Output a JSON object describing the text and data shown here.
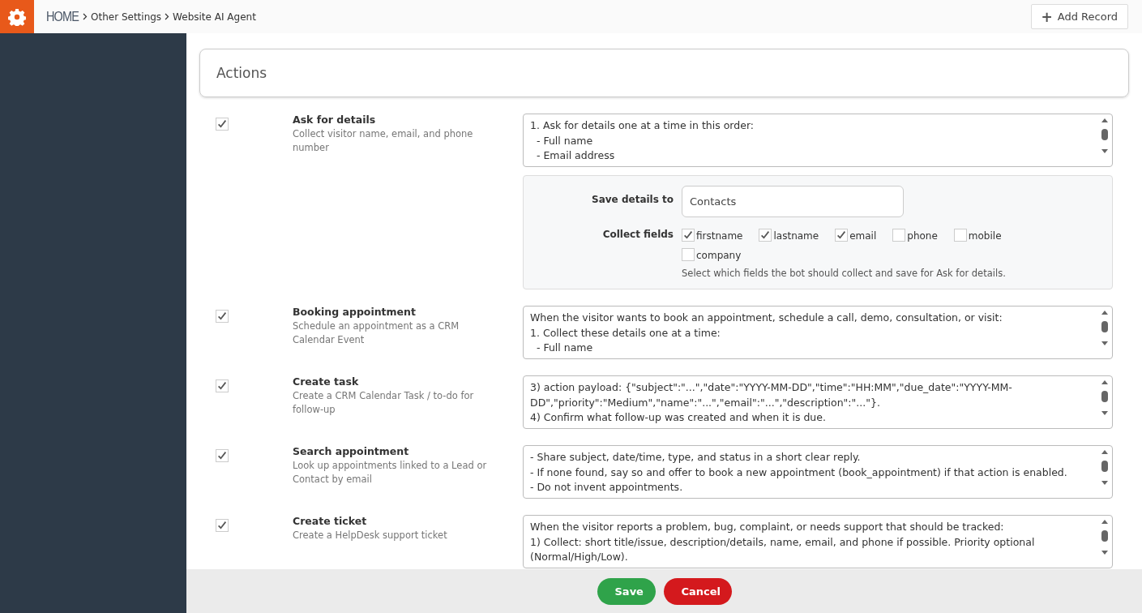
{
  "breadcrumb": {
    "home": "HOME",
    "items": [
      "Other Settings",
      "Website AI Agent"
    ]
  },
  "add_button": {
    "icon": "+",
    "label": "Add Record"
  },
  "panel": {
    "title": "Actions"
  },
  "actions": [
    {
      "title": "Ask for details",
      "description": "Collect visitor name, email, and phone number",
      "checked": true,
      "instructions": [
        "1. Ask for details one at a time in this order:",
        "  - Full name",
        "  - Email address"
      ],
      "details": {
        "save_label": "Save details to",
        "save_value": "Contacts",
        "collect_label": "Collect fields",
        "fields": [
          {
            "label": "firstname",
            "checked": true
          },
          {
            "label": "lastname",
            "checked": true
          },
          {
            "label": "email",
            "checked": true
          },
          {
            "label": "phone",
            "checked": false
          },
          {
            "label": "mobile",
            "checked": false
          },
          {
            "label": "company",
            "checked": false
          }
        ],
        "hint": "Select which fields the bot should collect and save for Ask for details."
      }
    },
    {
      "title": "Booking appointment",
      "description": "Schedule an appointment as a CRM Calendar Event",
      "checked": true,
      "instructions": [
        "When the visitor wants to book an appointment, schedule a call, demo, consultation, or visit:",
        "1. Collect these details one at a time:",
        "  - Full name"
      ]
    },
    {
      "title": "Create task",
      "description": "Create a CRM Calendar Task / to-do for follow-up",
      "checked": true,
      "instructions": [
        "3) action payload: {\"subject\":\"...\",\"date\":\"YYYY-MM-DD\",\"time\":\"HH:MM\",\"due_date\":\"YYYY-MM-DD\",\"priority\":\"Medium\",\"name\":\"...\",\"email\":\"...\",\"description\":\"...\"}.",
        "4) Confirm what follow-up was created and when it is due."
      ]
    },
    {
      "title": "Search appointment",
      "description": "Look up appointments linked to a Lead or Contact by email",
      "checked": true,
      "instructions": [
        "- Share subject, date/time, type, and status in a short clear reply.",
        "- If none found, say so and offer to book a new appointment (book_appointment) if that action is enabled.",
        "- Do not invent appointments."
      ]
    },
    {
      "title": "Create ticket",
      "description": "Create a HelpDesk support ticket",
      "checked": true,
      "instructions": [
        "When the visitor reports a problem, bug, complaint, or needs support that should be tracked:",
        "1) Collect: short title/issue, description/details, name, email, and phone if possible. Priority optional (Normal/High/Low)."
      ]
    }
  ],
  "buttons": [
    {
      "label": "Save",
      "kind": "primary"
    },
    {
      "label": "Cancel",
      "kind": "danger"
    }
  ]
}
